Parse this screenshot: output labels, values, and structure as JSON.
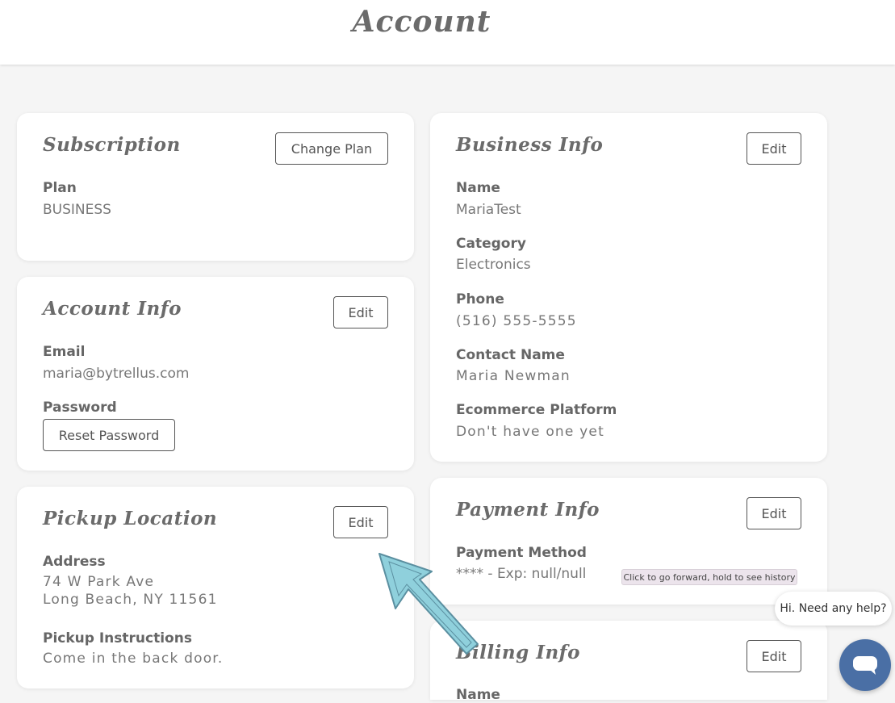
{
  "page": {
    "title": "Account"
  },
  "subscription": {
    "title": "Subscription",
    "button": "Change Plan",
    "plan_label": "Plan",
    "plan_value": "BUSINESS"
  },
  "account_info": {
    "title": "Account Info",
    "button": "Edit",
    "email_label": "Email",
    "email_value": "maria@bytrellus.com",
    "password_label": "Password",
    "reset_button": "Reset Password"
  },
  "pickup_location": {
    "title": "Pickup Location",
    "button": "Edit",
    "address_label": "Address",
    "address_line1": "74 W Park Ave",
    "address_line2": "Long Beach, NY 11561",
    "instructions_label": "Pickup Instructions",
    "instructions_value": "Come in the back door."
  },
  "business_info": {
    "title": "Business Info",
    "button": "Edit",
    "name_label": "Name",
    "name_value": "MariaTest",
    "category_label": "Category",
    "category_value": "Electronics",
    "phone_label": "Phone",
    "phone_value": "(516) 555-5555",
    "contact_label": "Contact Name",
    "contact_value": "Maria Newman",
    "platform_label": "Ecommerce Platform",
    "platform_value": "Don't have one yet"
  },
  "payment_info": {
    "title": "Payment Info",
    "button": "Edit",
    "method_label": "Payment Method",
    "method_value": "**** - Exp: null/null"
  },
  "billing_info": {
    "title": "Billing Info",
    "button": "Edit",
    "name_label": "Name"
  },
  "tooltip": {
    "text": "Click to go forward, hold to see history"
  },
  "chat": {
    "bubble_text": "Hi. Need any help?",
    "icon": "chat-icon"
  },
  "colors": {
    "chat_button": "#4a6fa5",
    "arrow": "#8fd0dc"
  }
}
